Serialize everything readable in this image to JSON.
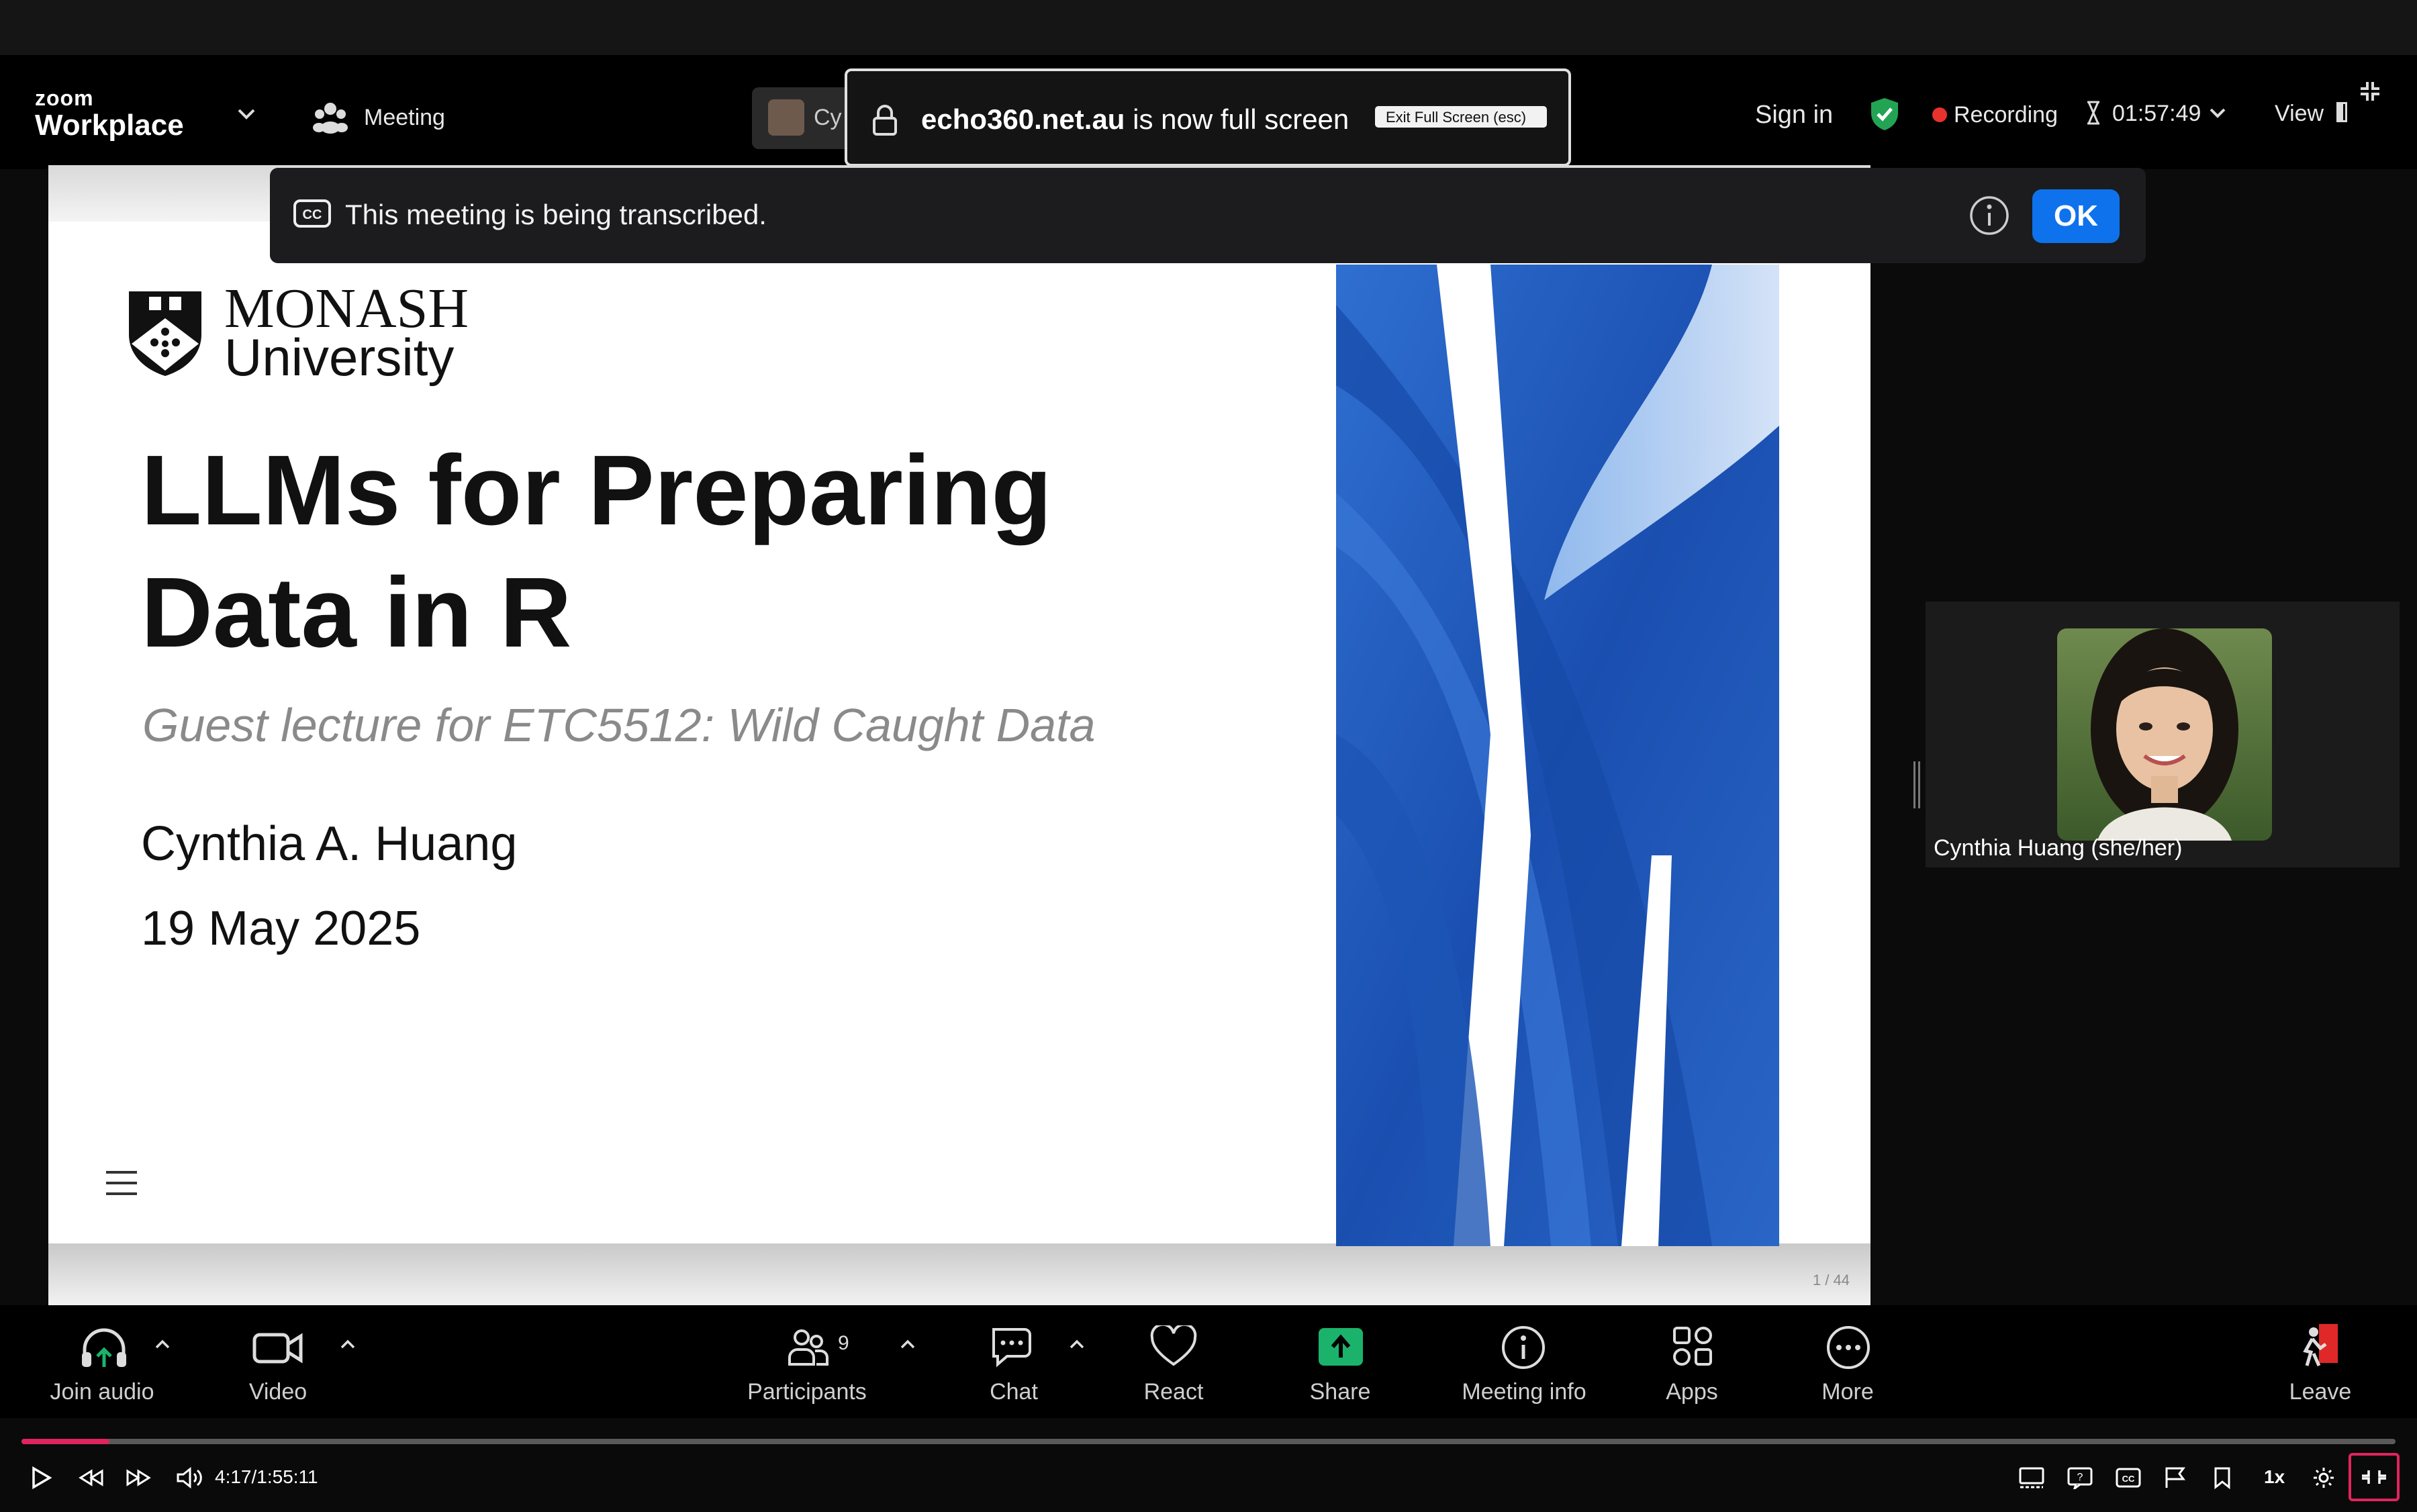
{
  "browser": {
    "fullscreen_domain": "echo360.net.au",
    "fullscreen_suffix": " is now full screen",
    "exit_fullscreen_label": "Exit Full Screen (esc)"
  },
  "zoom_header": {
    "logo_small": "zoom",
    "logo_big": "Workplace",
    "meeting_label": "Meeting",
    "speaker_chip": "Cy",
    "sign_in": "Sign in",
    "recording_label": "Recording",
    "timer": "01:57:49",
    "view_label": "View"
  },
  "transcription_banner": {
    "message": "This meeting is being transcribed.",
    "ok_label": "OK"
  },
  "slide": {
    "university_line1": "MONASH",
    "university_line2": "University",
    "title_line1": "LLMs for Preparing",
    "title_line2": "Data in R",
    "subtitle": "Guest lecture for ETC5512: Wild Caught Data",
    "author": "Cynthia A. Huang",
    "date": "19 May 2025",
    "page_indicator": "1 / 44"
  },
  "participant_tile": {
    "name": "Cynthia Huang (she/her)"
  },
  "toolbar": {
    "join_audio": "Join audio",
    "video": "Video",
    "participants": "Participants",
    "participants_count": "9",
    "chat": "Chat",
    "react": "React",
    "share": "Share",
    "meeting_info": "Meeting info",
    "apps": "Apps",
    "more": "More",
    "leave": "Leave"
  },
  "player": {
    "time": "4:17/1:55:11",
    "progress": 0.037,
    "speed": "1x",
    "progress_color": "#e0245e"
  },
  "colors": {
    "accent_blue": "#0e72ed",
    "shield_green": "#23a455",
    "recording_red": "#e8322c",
    "share_green": "#1bb36b",
    "leave_red": "#e02828"
  }
}
